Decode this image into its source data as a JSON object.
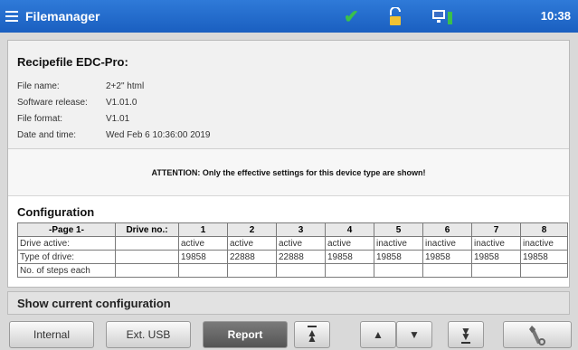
{
  "titlebar": {
    "title": "Filemanager",
    "clock": "10:38",
    "icons": [
      "menu-icon",
      "check-icon",
      "lock-icon",
      "network-icon"
    ],
    "check_color": "#3ac04b"
  },
  "report": {
    "recipe_title": "Recipefile EDC-Pro:",
    "info": [
      {
        "label": "File name:",
        "value": "2+2\" html"
      },
      {
        "label": "Software release:",
        "value": "V1.01.0"
      },
      {
        "label": "File format:",
        "value": "V1.01"
      },
      {
        "label": "Date and time:",
        "value": "Wed Feb 6 10:36:00 2019"
      }
    ],
    "attention": "ATTENTION: Only the effective settings for this device type are shown!",
    "config_title": "Configuration",
    "table": {
      "headers": [
        "-Page 1-",
        "Drive no.:",
        "1",
        "2",
        "3",
        "4",
        "5",
        "6",
        "7",
        "8"
      ],
      "rows": [
        [
          "Drive active:",
          "",
          "active",
          "active",
          "active",
          "active",
          "inactive",
          "inactive",
          "inactive",
          "inactive"
        ],
        [
          "Type of drive:",
          "",
          "19858",
          "22888",
          "22888",
          "19858",
          "19858",
          "19858",
          "19858",
          "19858"
        ],
        [
          "No. of steps each",
          "",
          "",
          "",
          "",
          "",
          "",
          "",
          "",
          ""
        ]
      ]
    }
  },
  "footer": {
    "status": "Show current configuration"
  },
  "toolbar": {
    "internal": "Internal",
    "ext_usb": "Ext. USB",
    "report": "Report"
  }
}
